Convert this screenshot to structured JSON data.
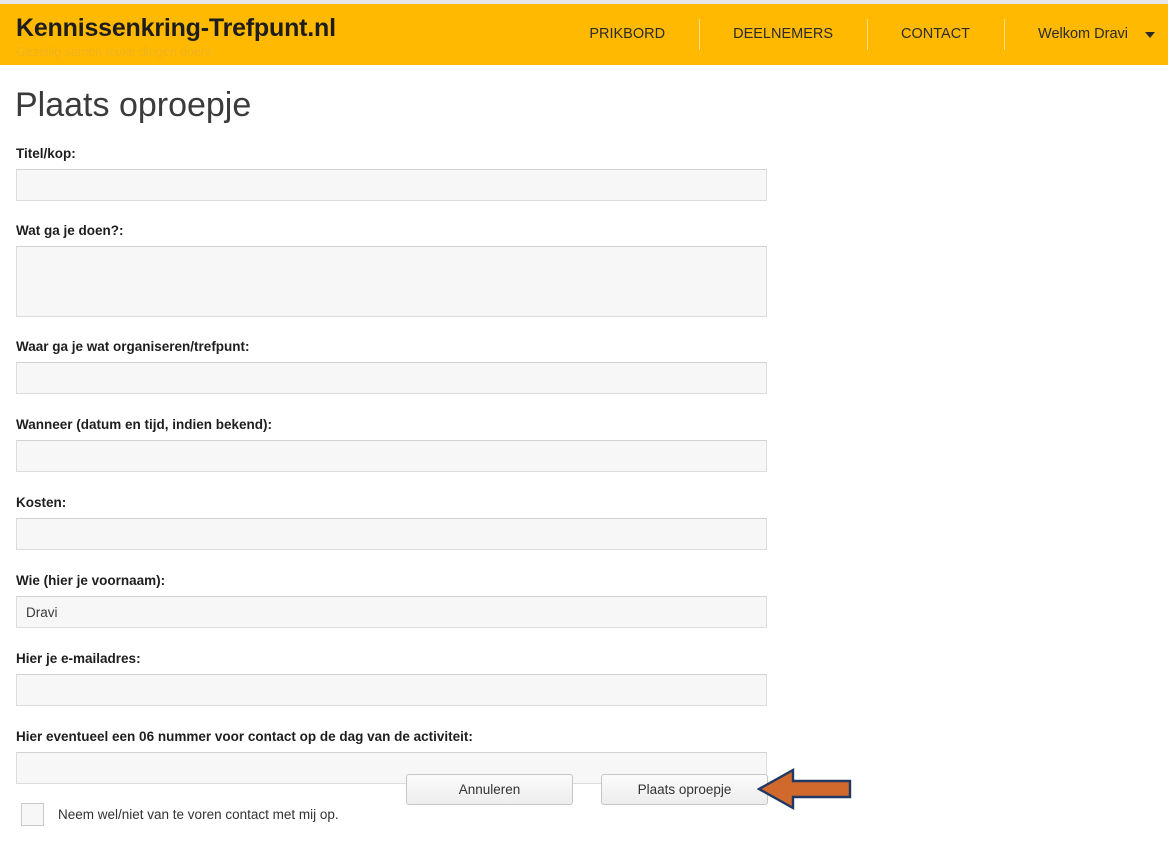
{
  "site": {
    "brand_title": "Kennissenkring-Trefpunt.nl",
    "brand_subtitle": "Gezellig samen leuke dingen doen!",
    "header_color": "#ffb900"
  },
  "nav": {
    "items": [
      {
        "label": "PRIKBORD"
      },
      {
        "label": "DEELNEMERS"
      },
      {
        "label": "CONTACT"
      }
    ],
    "user_label": "Welkom Dravi",
    "caret_icon": "chevron-down-icon"
  },
  "page": {
    "title": "Plaats oproepje"
  },
  "form": {
    "fields": [
      {
        "label": "Titel/kop:",
        "value": "",
        "placeholder": "",
        "type": "text"
      },
      {
        "label": "Wat ga je doen?:",
        "value": "",
        "placeholder": "",
        "type": "textarea"
      },
      {
        "label": "Waar ga je wat organiseren/trefpunt:",
        "value": "",
        "placeholder": "",
        "type": "text"
      },
      {
        "label": "Wanneer (datum en tijd, indien bekend):",
        "value": "",
        "placeholder": "",
        "type": "text"
      },
      {
        "label": "Kosten:",
        "value": "",
        "placeholder": "",
        "type": "text"
      },
      {
        "label": "Wie (hier je voornaam):",
        "value": "Dravi",
        "placeholder": "",
        "type": "text"
      },
      {
        "label": "Hier je e-mailadres:",
        "value": "",
        "placeholder": "",
        "type": "text"
      },
      {
        "label": "Hier eventueel een 06 nummer voor contact op de dag van de activiteit:",
        "value": "",
        "placeholder": "",
        "type": "text"
      }
    ],
    "checkbox": {
      "label": "Neem wel/niet van te voren contact met mij op.",
      "checked": false
    },
    "buttons": {
      "cancel_label": "Annuleren",
      "submit_label": "Plaats oproepje"
    }
  },
  "annotation": {
    "arrow_icon": "left-arrow-annotation",
    "fill_color": "#d2692c",
    "stroke_color": "#1f3864"
  }
}
